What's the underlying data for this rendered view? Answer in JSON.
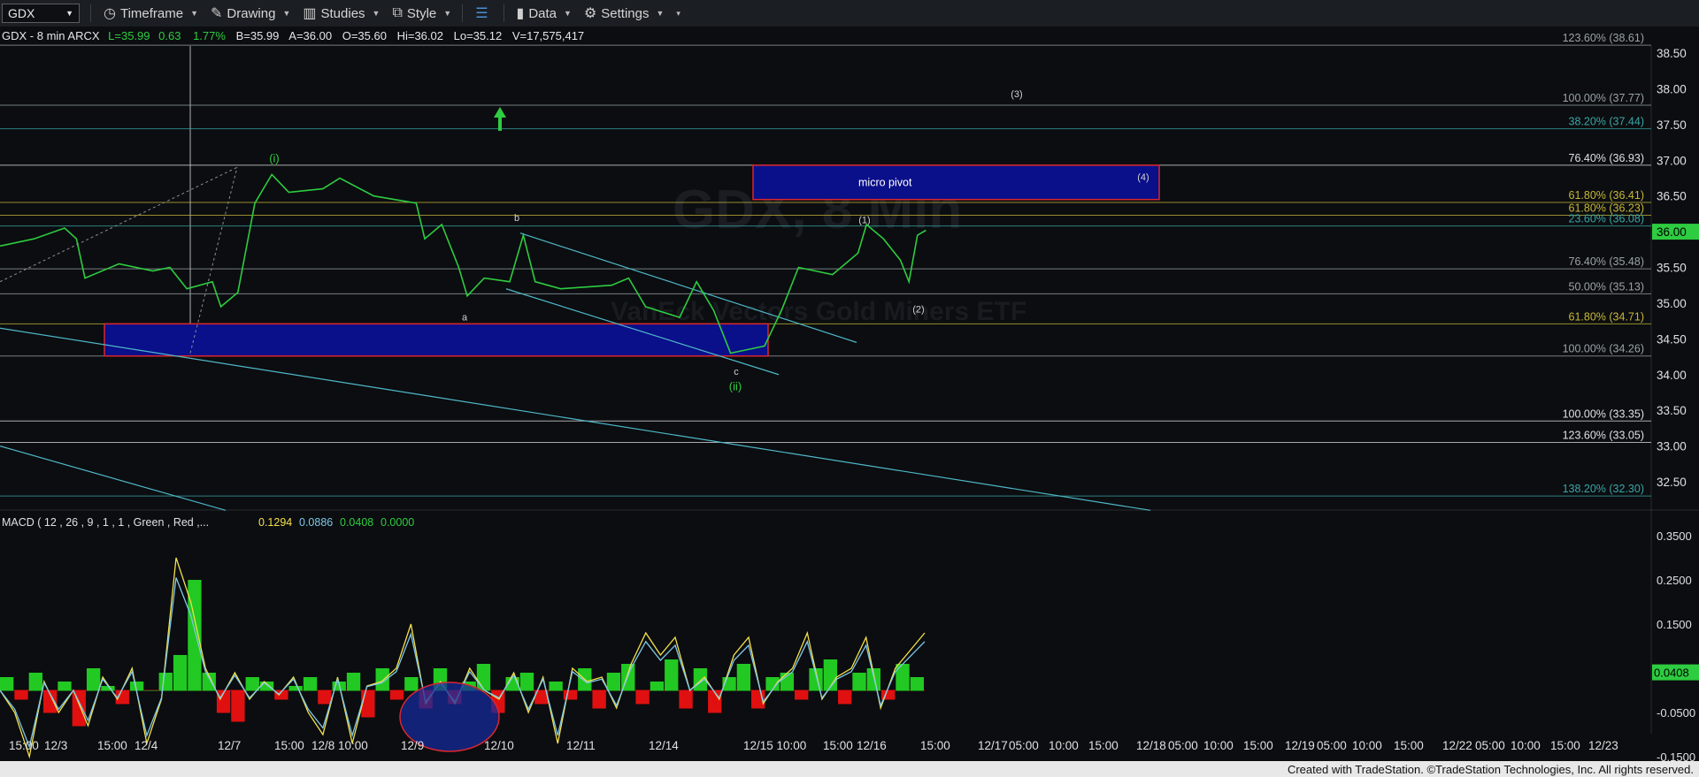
{
  "toolbar": {
    "symbol": "GDX",
    "timeframe": "Timeframe",
    "drawing": "Drawing",
    "studies": "Studies",
    "style": "Style",
    "data": "Data",
    "settings": "Settings"
  },
  "header": {
    "symbol_line": "GDX - 8 min  ARCX",
    "last": "L=35.99",
    "change": "0.63",
    "change_pct": "1.77%",
    "bid": "B=35.99",
    "ask": "A=36.00",
    "open": "O=35.60",
    "high": "Hi=36.02",
    "low": "Lo=35.12",
    "volume": "V=17,575,417"
  },
  "watermark": {
    "title": "GDX, 8 Min",
    "subtitle": "VanEck Vectors Gold Miners ETF"
  },
  "colors": {
    "background": "#0b0d10",
    "price_line": "#2ecc40",
    "channel": "#4fb8c8",
    "box_fill": "#0a0f8a",
    "box_border": "#d8272f",
    "macd_pos": "#22c922",
    "macd_neg": "#e01010",
    "macd_line": "#f4e04a",
    "signal_line": "#7fc8e8",
    "last_price_bg": "#2ecc40"
  },
  "chart_data": {
    "type": "line",
    "title": "",
    "price_axis": {
      "min": 32.0,
      "max": 38.75,
      "ticks": [
        38.5,
        38.0,
        37.5,
        37.0,
        36.5,
        36.0,
        35.5,
        35.0,
        34.5,
        34.0,
        33.5,
        33.0,
        32.5
      ]
    },
    "last_price": "36.00",
    "x_labels": [
      "15:00",
      "12/3",
      "15:00",
      "12/4",
      "12/7",
      "15:00",
      "12/8 10:00",
      "12/9",
      "12/10",
      "12/11",
      "12/14",
      "12/15 10:00",
      "15:00",
      "12/16",
      "15:00",
      "12/17",
      "05:00",
      "10:00",
      "15:00",
      "12/18",
      "05:00",
      "10:00",
      "15:00",
      "12/19",
      "05:00",
      "10:00",
      "15:00",
      "12/22",
      "05:00",
      "10:00",
      "15:00",
      "12/23"
    ],
    "price_series": [
      {
        "x": 0,
        "y": 35.8
      },
      {
        "x": 0.02,
        "y": 35.9
      },
      {
        "x": 0.038,
        "y": 36.05
      },
      {
        "x": 0.045,
        "y": 35.9
      },
      {
        "x": 0.05,
        "y": 35.35
      },
      {
        "x": 0.07,
        "y": 35.55
      },
      {
        "x": 0.09,
        "y": 35.45
      },
      {
        "x": 0.1,
        "y": 35.5
      },
      {
        "x": 0.11,
        "y": 35.2
      },
      {
        "x": 0.125,
        "y": 35.3
      },
      {
        "x": 0.13,
        "y": 34.95
      },
      {
        "x": 0.14,
        "y": 35.15
      },
      {
        "x": 0.15,
        "y": 36.4
      },
      {
        "x": 0.16,
        "y": 36.8
      },
      {
        "x": 0.17,
        "y": 36.55
      },
      {
        "x": 0.19,
        "y": 36.6
      },
      {
        "x": 0.2,
        "y": 36.75
      },
      {
        "x": 0.22,
        "y": 36.5
      },
      {
        "x": 0.245,
        "y": 36.4
      },
      {
        "x": 0.25,
        "y": 35.9
      },
      {
        "x": 0.26,
        "y": 36.1
      },
      {
        "x": 0.27,
        "y": 35.5
      },
      {
        "x": 0.275,
        "y": 35.1
      },
      {
        "x": 0.285,
        "y": 35.35
      },
      {
        "x": 0.3,
        "y": 35.3
      },
      {
        "x": 0.308,
        "y": 35.95
      },
      {
        "x": 0.315,
        "y": 35.3
      },
      {
        "x": 0.33,
        "y": 35.2
      },
      {
        "x": 0.36,
        "y": 35.25
      },
      {
        "x": 0.37,
        "y": 35.35
      },
      {
        "x": 0.38,
        "y": 34.95
      },
      {
        "x": 0.4,
        "y": 34.8
      },
      {
        "x": 0.41,
        "y": 35.3
      },
      {
        "x": 0.42,
        "y": 34.9
      },
      {
        "x": 0.43,
        "y": 34.3
      },
      {
        "x": 0.44,
        "y": 34.35
      },
      {
        "x": 0.45,
        "y": 34.4
      },
      {
        "x": 0.46,
        "y": 34.9
      },
      {
        "x": 0.47,
        "y": 35.5
      },
      {
        "x": 0.49,
        "y": 35.4
      },
      {
        "x": 0.505,
        "y": 35.7
      },
      {
        "x": 0.51,
        "y": 36.1
      },
      {
        "x": 0.52,
        "y": 35.9
      },
      {
        "x": 0.53,
        "y": 35.6
      },
      {
        "x": 0.535,
        "y": 35.3
      },
      {
        "x": 0.54,
        "y": 35.95
      },
      {
        "x": 0.545,
        "y": 36.02
      }
    ],
    "levels": [
      {
        "label": "123.60% (38.61)",
        "value": 38.61,
        "color": "#9aa3a8"
      },
      {
        "label": "100.00% (37.77)",
        "value": 37.77,
        "color": "#9aa3a8"
      },
      {
        "label": "38.20% (37.44)",
        "value": 37.44,
        "color": "#3aa6a6"
      },
      {
        "label": "76.40% (36.93)",
        "value": 36.93,
        "color": "#e0e0e0"
      },
      {
        "label": "61.80% (36.41)",
        "value": 36.41,
        "color": "#c8b838"
      },
      {
        "label": "61.80% (36.23)",
        "value": 36.23,
        "color": "#c8b838"
      },
      {
        "label": "23.60% (36.08)",
        "value": 36.08,
        "color": "#3aa6a6"
      },
      {
        "label": "76.40% (35.48)",
        "value": 35.48,
        "color": "#9aa3a8"
      },
      {
        "label": "50.00% (35.13)",
        "value": 35.13,
        "color": "#9aa3a8"
      },
      {
        "label": "61.80% (34.71)",
        "value": 34.71,
        "color": "#c8b838"
      },
      {
        "label": "100.00% (34.26)",
        "value": 34.26,
        "color": "#9aa3a8"
      },
      {
        "label": "100.00% (33.35)",
        "value": 33.35,
        "color": "#e0e0e0"
      },
      {
        "label": "123.60% (33.05)",
        "value": 33.05,
        "color": "#e0e0e0"
      },
      {
        "label": "138.20% (32.30)",
        "value": 32.3,
        "color": "#3aa6a6"
      }
    ],
    "annotations": [
      {
        "text": "(i)",
        "color": "#2ecc40"
      },
      {
        "text": "(ii)",
        "color": "#2ecc40"
      },
      {
        "text": "a",
        "color": "#cfcfcf"
      },
      {
        "text": "b",
        "color": "#cfcfcf"
      },
      {
        "text": "c",
        "color": "#cfcfcf"
      },
      {
        "text": "(1)",
        "color": "#cfcfcf"
      },
      {
        "text": "(2)",
        "color": "#cfcfcf"
      },
      {
        "text": "(3)",
        "color": "#cfcfcf"
      },
      {
        "text": "(4)",
        "color": "#cfcfcf"
      },
      {
        "text": "micro pivot",
        "color": "#ffffff"
      }
    ],
    "macd": {
      "label": "MACD ( 12 , 26 , 9 , 1 , 1 , Green , Red ,...",
      "values": [
        "0.1294",
        "0.0886",
        "0.0408",
        "0.0000"
      ],
      "value_colors": [
        "#f4e04a",
        "#7fc8e8",
        "#2ecc40",
        "#2ecc40"
      ],
      "axis": {
        "min": -0.19,
        "max": 0.38,
        "ticks": [
          "0.3500",
          "0.2500",
          "0.1500",
          "-0.0500",
          "-0.1500"
        ]
      },
      "last_value": "0.0408"
    }
  },
  "footer": {
    "credit": "Created with TradeStation. ©TradeStation Technologies, Inc. All rights reserved."
  }
}
